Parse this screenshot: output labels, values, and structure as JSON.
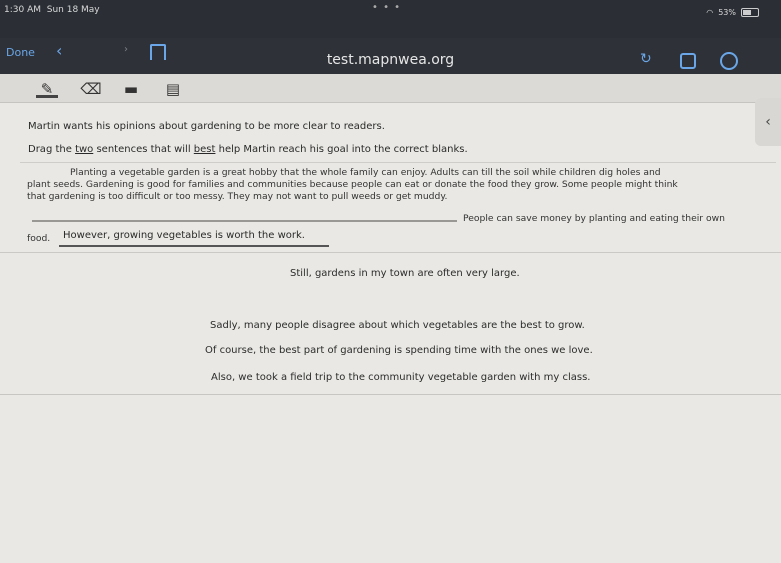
{
  "status_bar": {
    "time": "1:30 AM",
    "date": "Sun 18 May",
    "dots": "• • •",
    "battery": "53%"
  },
  "browser": {
    "done_label": "Done",
    "url": "test.mapnwea.org"
  },
  "question": {
    "prompt_1": "Martin wants his opinions about gardening to be more clear to readers.",
    "prompt_2_pre": "Drag the ",
    "prompt_2_two": "two",
    "prompt_2_mid": " sentences that will ",
    "prompt_2_best": "best",
    "prompt_2_post": " help Martin reach his goal into the correct blanks."
  },
  "passage": {
    "line_1": "Planting a vegetable garden is a great hobby that the whole family can enjoy. Adults can till the soil while children dig holes and",
    "line_2": "plant seeds. Gardening is good for families and communities because people can eat or donate the food they grow. Some people might think",
    "line_3": "that gardening is too difficult or too messy. They may not want to pull weeds or get muddy.",
    "line_4": "People can save money by planting and eating their own",
    "line_5": "food.",
    "filled_blank": "However, growing vegetables is worth the work."
  },
  "choices": [
    "Still, gardens in my town are often very large.",
    "Sadly, many people disagree about which vegetables are the best to grow.",
    "Of course, the best part of gardening is spending time with the ones we love.",
    "Also, we took a field trip to the community vegetable garden with my class."
  ]
}
